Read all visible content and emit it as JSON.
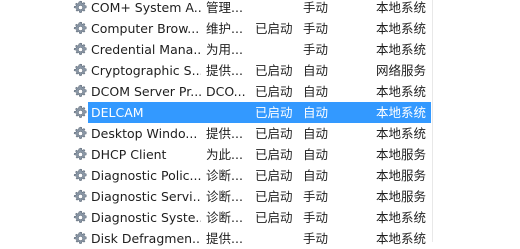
{
  "services": [
    {
      "name": "COM+ System A...",
      "desc": "管理...",
      "status": "",
      "startup": "手动",
      "logon": "本地系统"
    },
    {
      "name": "Computer Brow...",
      "desc": "维护...",
      "status": "已启动",
      "startup": "手动",
      "logon": "本地系统"
    },
    {
      "name": "Credential Mana...",
      "desc": "为用...",
      "status": "",
      "startup": "手动",
      "logon": "本地系统"
    },
    {
      "name": "Cryptographic S...",
      "desc": "提供...",
      "status": "已启动",
      "startup": "自动",
      "logon": "网络服务"
    },
    {
      "name": "DCOM Server Pr...",
      "desc": "DCO...",
      "status": "已启动",
      "startup": "自动",
      "logon": "本地系统"
    },
    {
      "name": "DELCAM",
      "desc": "",
      "status": "已启动",
      "startup": "自动",
      "logon": "本地系统",
      "selected": true
    },
    {
      "name": "Desktop Windo...",
      "desc": "提供...",
      "status": "已启动",
      "startup": "自动",
      "logon": "本地系统"
    },
    {
      "name": "DHCP Client",
      "desc": "为此...",
      "status": "已启动",
      "startup": "自动",
      "logon": "本地服务"
    },
    {
      "name": "Diagnostic Polic...",
      "desc": "诊断...",
      "status": "已启动",
      "startup": "自动",
      "logon": "本地服务"
    },
    {
      "name": "Diagnostic Servi...",
      "desc": "诊断...",
      "status": "已启动",
      "startup": "手动",
      "logon": "本地服务"
    },
    {
      "name": "Diagnostic Syste...",
      "desc": "诊断...",
      "status": "已启动",
      "startup": "手动",
      "logon": "本地系统"
    },
    {
      "name": "Disk Defragmen...",
      "desc": "提供...",
      "status": "",
      "startup": "手动",
      "logon": "本地系统"
    }
  ],
  "icon": "gear-icon",
  "colors": {
    "selection": "#3399ff"
  }
}
